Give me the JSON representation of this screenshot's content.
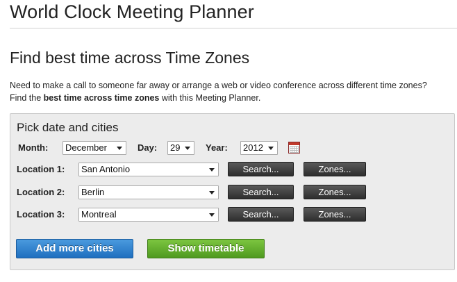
{
  "header": {
    "title": "World Clock Meeting Planner"
  },
  "section": {
    "title": "Find best time across Time Zones",
    "intro_line1": "Need to make a call to someone far away or arrange a web or video conference across different time zones?",
    "intro_line2_pre": "Find the ",
    "intro_line2_bold": "best time across time zones",
    "intro_line2_post": " with this Meeting Planner."
  },
  "form": {
    "panel_title": "Pick date and cities",
    "month_label": "Month:",
    "month_value": "December",
    "day_label": "Day:",
    "day_value": "29",
    "year_label": "Year:",
    "year_value": "2012",
    "calendar_icon": "calendar-icon",
    "locations": [
      {
        "label": "Location 1:",
        "city": "San Antonio"
      },
      {
        "label": "Location 2:",
        "city": "Berlin"
      },
      {
        "label": "Location 3:",
        "city": "Montreal"
      }
    ],
    "search_label": "Search...",
    "zones_label": "Zones...",
    "add_cities_label": "Add more cities",
    "show_timetable_label": "Show timetable"
  },
  "colors": {
    "add_button": "#2b7fd0",
    "show_button": "#62b12f",
    "panel_bg": "#ececec"
  }
}
